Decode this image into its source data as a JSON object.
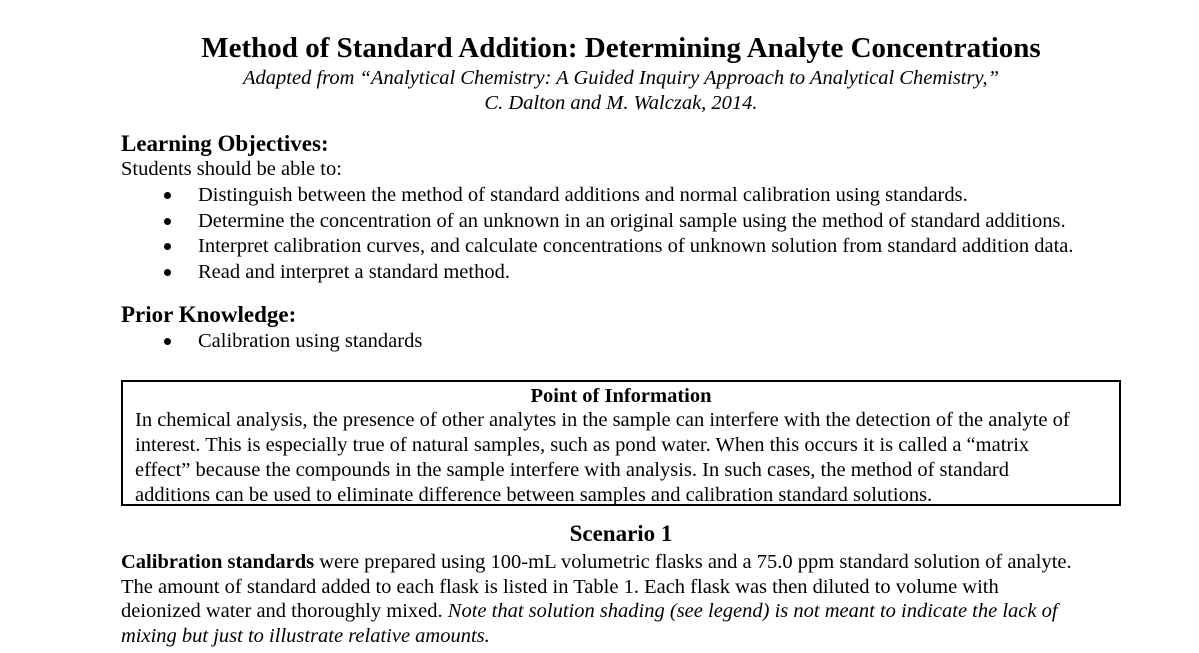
{
  "document": {
    "title": "Method of Standard Addition: Determining Analyte Concentrations",
    "subtitle_line1": "Adapted from “Analytical Chemistry: A Guided Inquiry Approach to Analytical Chemistry,”",
    "subtitle_line2": "C. Dalton and M. Walczak, 2014."
  },
  "learning_objectives": {
    "heading": "Learning Objectives:",
    "intro": "Students should be able to:",
    "items": [
      "Distinguish between the method of standard additions and normal calibration using standards.",
      "Determine the concentration of an unknown in an original sample using the method of standard additions.",
      "Interpret calibration curves, and calculate concentrations of unknown solution from standard addition data.",
      "Read and interpret a standard method."
    ]
  },
  "prior_knowledge": {
    "heading": "Prior Knowledge:",
    "items": [
      "Calibration using standards"
    ]
  },
  "point_of_information": {
    "title": "Point of Information",
    "lines": [
      "In chemical analysis, the presence of other analytes in the sample can interfere with the detection of the analyte of",
      "interest. This is especially true of natural samples, such as pond water. When this occurs it is called a “matrix",
      "effect” because the compounds in the sample interfere with analysis. In such cases, the method of standard",
      "additions can be used to eliminate difference between samples and calibration standard solutions."
    ]
  },
  "scenario": {
    "title": "Scenario 1",
    "line1_bold": "Calibration standards",
    "line1_rest": " were prepared using 100-mL volumetric flasks and a 75.0 ppm standard solution of analyte.",
    "line2": "The amount of standard added to each flask is listed in Table 1. Each flask was then diluted to volume with",
    "line3_normal": "deionized water and thoroughly mixed. ",
    "line3_italic": "Note that solution shading (see legend) is not meant to indicate the lack of",
    "line4_italic": "mixing but just to illustrate relative amounts."
  }
}
